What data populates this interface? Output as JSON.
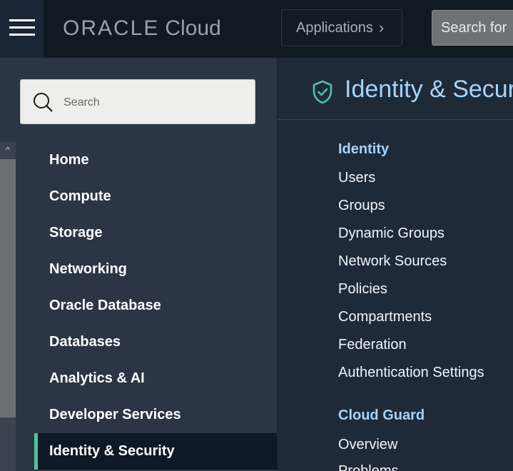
{
  "header": {
    "brand": "ORACLE",
    "product": "Cloud",
    "applications_label": "Applications",
    "search_label": "Search for"
  },
  "sidenav": {
    "search_placeholder": "Search",
    "items": [
      {
        "label": "Home"
      },
      {
        "label": "Compute"
      },
      {
        "label": "Storage"
      },
      {
        "label": "Networking"
      },
      {
        "label": "Oracle Database"
      },
      {
        "label": "Databases"
      },
      {
        "label": "Analytics & AI"
      },
      {
        "label": "Developer Services"
      },
      {
        "label": "Identity & Security",
        "active": true
      }
    ]
  },
  "panel": {
    "title": "Identity & Security",
    "sections": [
      {
        "heading": "Identity",
        "links": [
          "Users",
          "Groups",
          "Dynamic Groups",
          "Network Sources",
          "Policies",
          "Compartments",
          "Federation",
          "Authentication Settings"
        ]
      },
      {
        "heading": "Cloud Guard",
        "links": [
          "Overview",
          "Problems"
        ]
      }
    ]
  },
  "colors": {
    "topbar": "#111923",
    "sidenav": "#2b3544",
    "panel": "#1f2a39",
    "accent": "#4fc3a1",
    "heading": "#a7d3f8"
  }
}
